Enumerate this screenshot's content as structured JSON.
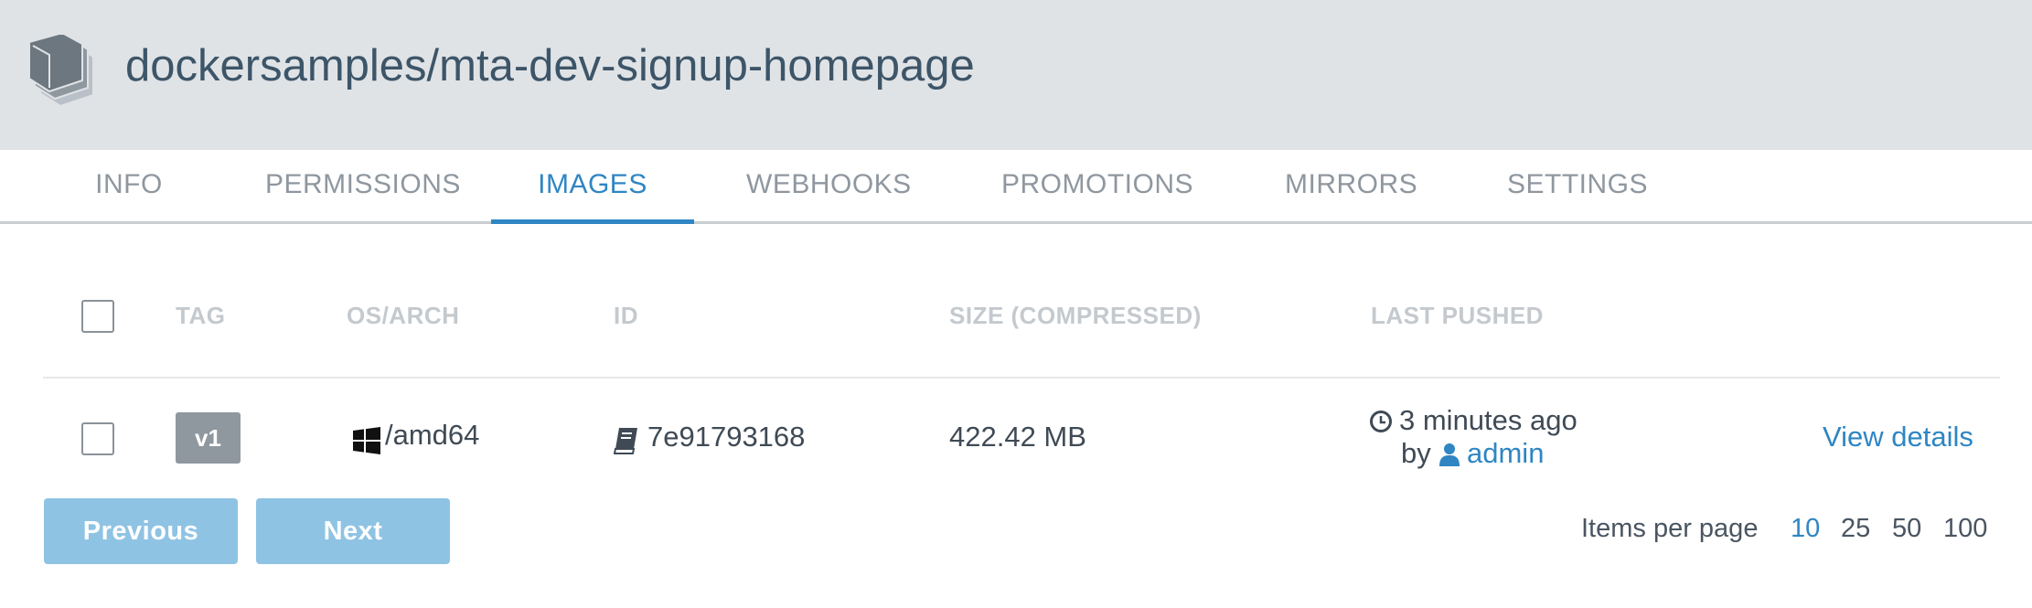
{
  "header": {
    "icon": "repository-books-icon",
    "title": "dockersamples/mta-dev-signup-homepage"
  },
  "tabs": [
    {
      "label": "INFO",
      "active": false
    },
    {
      "label": "PERMISSIONS",
      "active": false
    },
    {
      "label": "IMAGES",
      "active": true
    },
    {
      "label": "WEBHOOKS",
      "active": false
    },
    {
      "label": "PROMOTIONS",
      "active": false
    },
    {
      "label": "MIRRORS",
      "active": false
    },
    {
      "label": "SETTINGS",
      "active": false
    }
  ],
  "table": {
    "columns": [
      "TAG",
      "OS/ARCH",
      "ID",
      "SIZE (COMPRESSED)",
      "LAST PUSHED"
    ],
    "rows": [
      {
        "tag": "v1",
        "os_icon": "windows-icon",
        "arch": "/amd64",
        "id_icon": "book-icon",
        "id": "7e91793168",
        "size": "422.42 MB",
        "pushed_icon": "clock-icon",
        "pushed": "3 minutes ago",
        "by_label": "by",
        "user_icon": "user-icon",
        "user": "admin",
        "action": "View details"
      }
    ]
  },
  "pagination": {
    "previous": "Previous",
    "next": "Next",
    "items_per_page_label": "Items per page",
    "options": [
      "10",
      "25",
      "50",
      "100"
    ],
    "selected": "10"
  },
  "colors": {
    "accent": "#2f86c3",
    "header_bg": "#e0e3e6",
    "button_bg": "#8fc3e3",
    "tag_badge": "#8f979f"
  }
}
